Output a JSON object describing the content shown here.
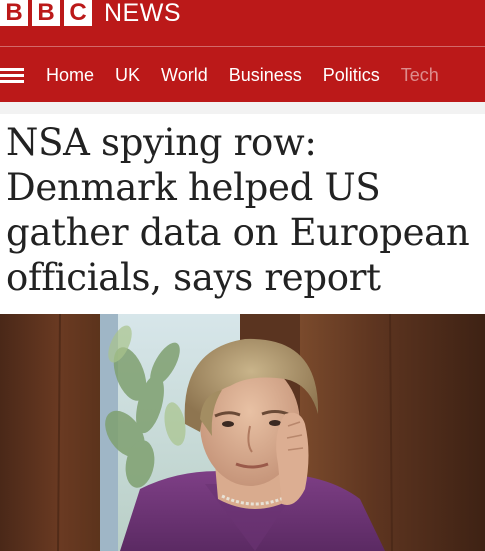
{
  "brand": {
    "letters": [
      "B",
      "B",
      "C"
    ],
    "name": "NEWS"
  },
  "nav": {
    "items": [
      "Home",
      "UK",
      "World",
      "Business",
      "Politics",
      "Tech"
    ]
  },
  "article": {
    "headline_lines": [
      "NSA spying row:",
      "Denmark helped US",
      "gather data on European",
      "officials, says report"
    ]
  },
  "icons": {
    "menu": "hamburger-menu-icon"
  },
  "colors": {
    "brand_red": "#bb1919",
    "text": "#222222",
    "background": "#ffffff"
  }
}
